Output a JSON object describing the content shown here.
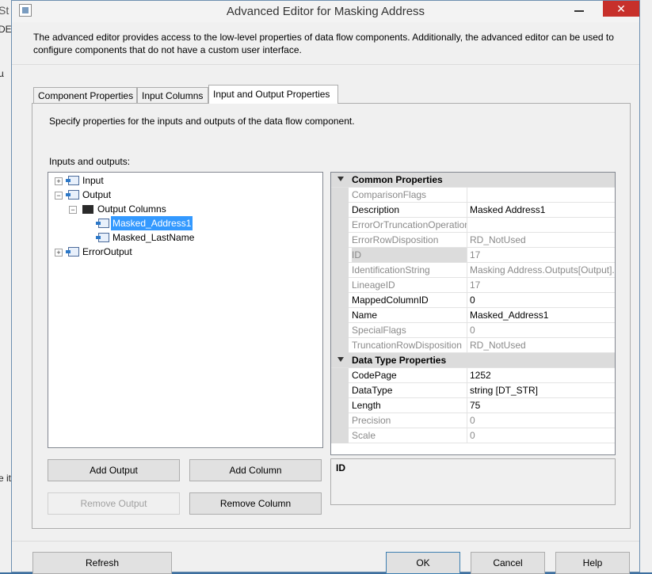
{
  "background": {
    "left_texts": [
      "St",
      "DEE",
      "µ",
      "e it"
    ]
  },
  "window": {
    "title": "Advanced Editor for Masking Address",
    "close_glyph": "✕",
    "description": "The advanced editor provides access to the low-level properties of data flow components. Additionally, the advanced editor can be used to configure components that do not have a custom user interface."
  },
  "tabs": [
    {
      "label": "Component Properties",
      "active": false
    },
    {
      "label": "Input Columns",
      "active": false
    },
    {
      "label": "Input and Output Properties",
      "active": true
    }
  ],
  "panel": {
    "instructions": "Specify properties for the inputs and outputs of the data flow component.",
    "tree_label": "Inputs and outputs:"
  },
  "tree": {
    "input": "Input",
    "output": "Output",
    "output_columns": "Output Columns",
    "column1": "Masked_Address1",
    "column2": "Masked_LastName",
    "error_output": "ErrorOutput",
    "expand_glyph": "+",
    "collapse_glyph": "−"
  },
  "buttons": {
    "add_output": "Add Output",
    "add_column": "Add Column",
    "remove_output": "Remove Output",
    "remove_column": "Remove Column",
    "refresh": "Refresh",
    "ok": "OK",
    "cancel": "Cancel",
    "help": "Help"
  },
  "properties": {
    "common_header": "Common Properties",
    "common": [
      {
        "name": "ComparisonFlags",
        "value": "",
        "readonly": true
      },
      {
        "name": "Description",
        "value": "Masked Address1",
        "readonly": false
      },
      {
        "name": "ErrorOrTruncationOperation",
        "value": "",
        "readonly": true
      },
      {
        "name": "ErrorRowDisposition",
        "value": "RD_NotUsed",
        "readonly": true
      },
      {
        "name": "ID",
        "value": "17",
        "readonly": true
      },
      {
        "name": "IdentificationString",
        "value": "Masking Address.Outputs[Output].",
        "readonly": true
      },
      {
        "name": "LineageID",
        "value": "17",
        "readonly": true
      },
      {
        "name": "MappedColumnID",
        "value": "0",
        "readonly": false
      },
      {
        "name": "Name",
        "value": "Masked_Address1",
        "readonly": false
      },
      {
        "name": "SpecialFlags",
        "value": "0",
        "readonly": true
      },
      {
        "name": "TruncationRowDisposition",
        "value": "RD_NotUsed",
        "readonly": true
      }
    ],
    "datatype_header": "Data Type Properties",
    "datatype": [
      {
        "name": "CodePage",
        "value": "1252",
        "readonly": false
      },
      {
        "name": "DataType",
        "value": "string [DT_STR]",
        "readonly": false
      },
      {
        "name": "Length",
        "value": "75",
        "readonly": false
      },
      {
        "name": "Precision",
        "value": "0",
        "readonly": true
      },
      {
        "name": "Scale",
        "value": "0",
        "readonly": true
      }
    ]
  },
  "description_box": {
    "title": "ID"
  },
  "colors": {
    "selection": "#3399ff",
    "close_button": "#c7302b",
    "category_header": "#dcdcdc",
    "readonly_text": "#8a8a8a"
  }
}
